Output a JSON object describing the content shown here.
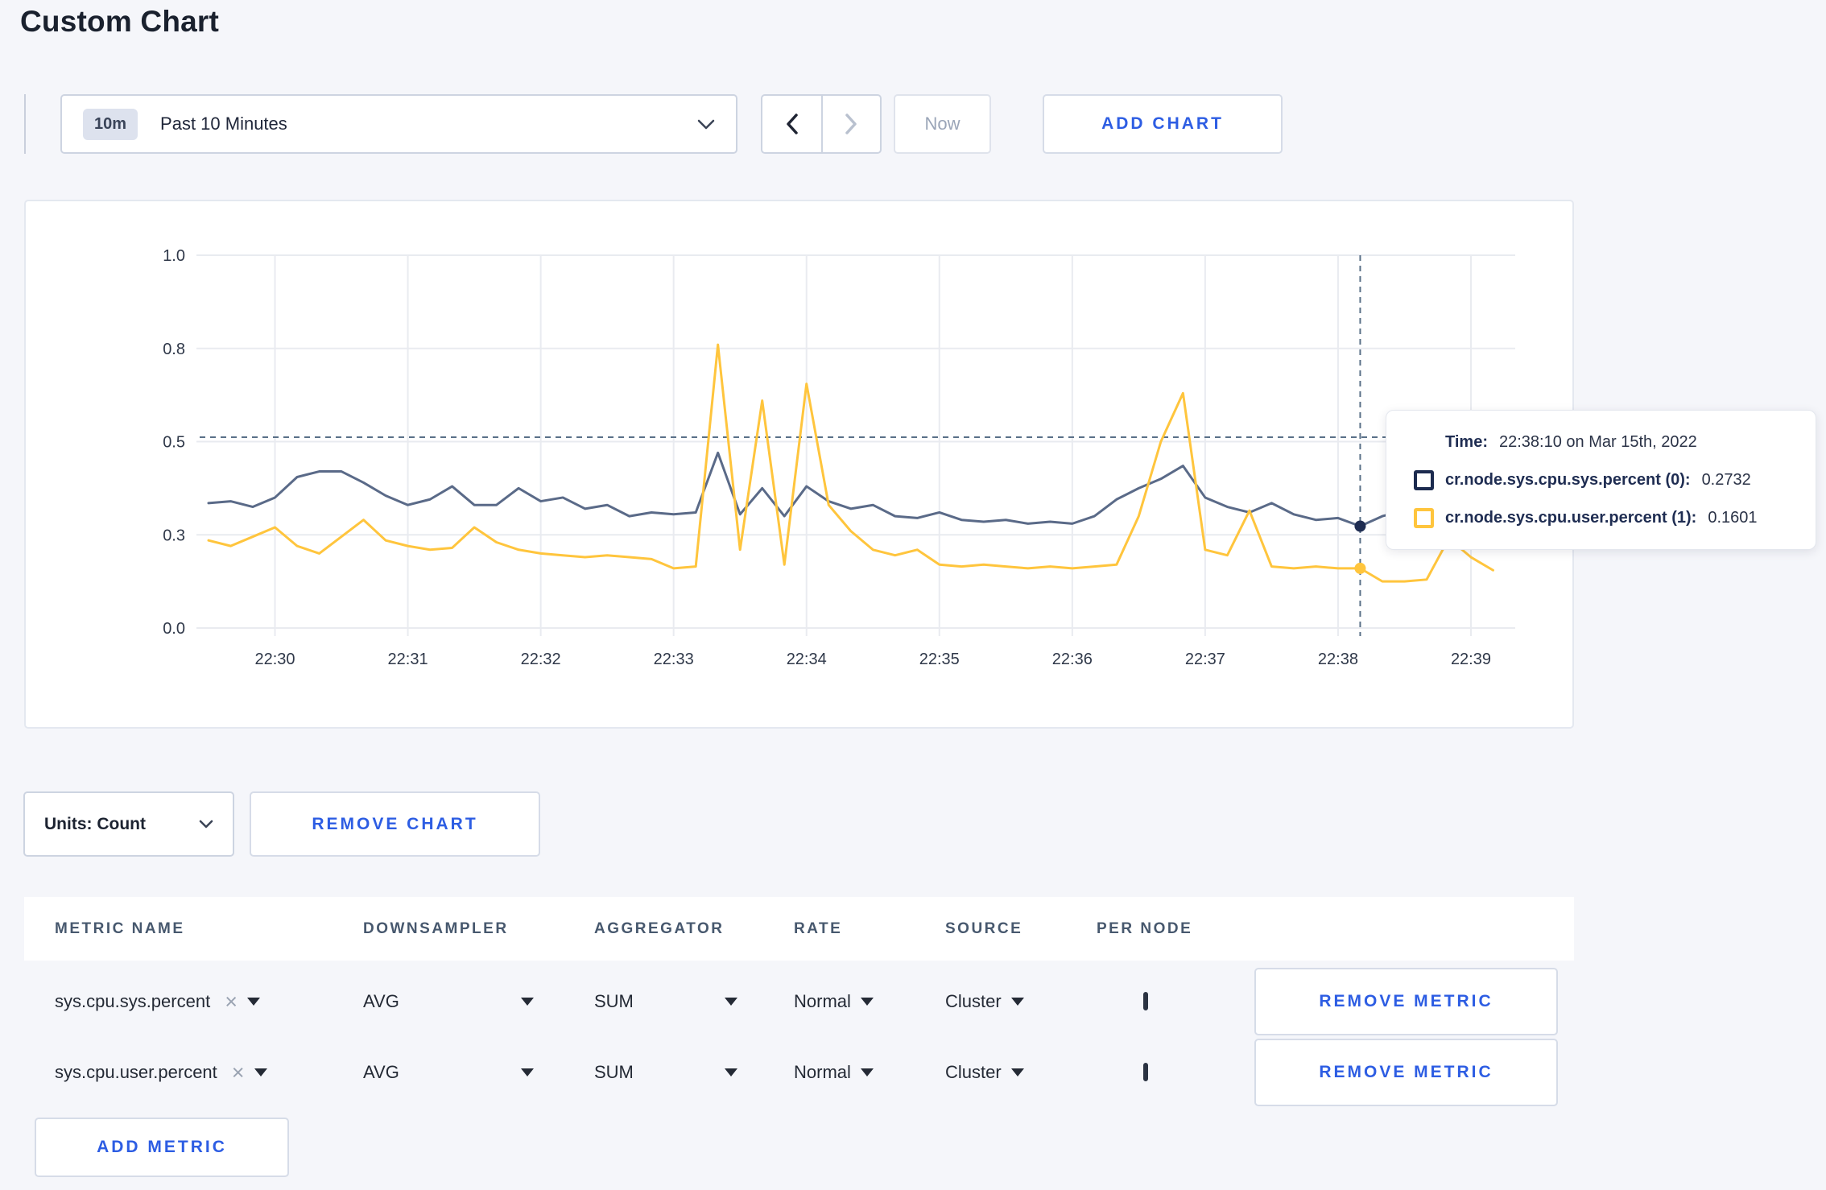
{
  "page": {
    "title": "Custom Chart"
  },
  "accent_color": "#2d5de3",
  "toolbar": {
    "time_scale_badge": "10m",
    "time_scale_label": "Past 10 Minutes",
    "now_label": "Now",
    "add_chart_label": "ADD CHART"
  },
  "chart_controls": {
    "units_label": "Units: Count",
    "remove_chart_label": "REMOVE CHART",
    "add_metric_label": "ADD METRIC"
  },
  "tooltip": {
    "time_label": "Time:",
    "time_value": "22:38:10 on Mar 15th, 2022",
    "series": [
      {
        "label": "cr.node.sys.cpu.sys.percent (0):",
        "value": "0.2732",
        "color": "#1c2b4f"
      },
      {
        "label": "cr.node.sys.cpu.user.percent (1):",
        "value": "0.1601",
        "color": "#ffc53d"
      }
    ]
  },
  "metrics_table": {
    "headers": [
      "METRIC NAME",
      "DOWNSAMPLER",
      "AGGREGATOR",
      "RATE",
      "SOURCE",
      "PER NODE"
    ],
    "rows": [
      {
        "metric": "sys.cpu.sys.percent",
        "clear": "×",
        "downsampler": "AVG",
        "aggregator": "SUM",
        "rate": "Normal",
        "source": "Cluster",
        "per_node_checked": false,
        "remove_label": "REMOVE METRIC"
      },
      {
        "metric": "sys.cpu.user.percent",
        "clear": "×",
        "downsampler": "AVG",
        "aggregator": "SUM",
        "rate": "Normal",
        "source": "Cluster",
        "per_node_checked": false,
        "remove_label": "REMOVE METRIC"
      }
    ]
  },
  "chart_data": {
    "type": "line",
    "grid": true,
    "ylim": [
      0,
      1
    ],
    "y_ticks": [
      {
        "label": "0.0",
        "value": 0
      },
      {
        "label": "0.3",
        "value": 0.25
      },
      {
        "label": "0.5",
        "value": 0.5
      },
      {
        "label": "0.8",
        "value": 0.75
      },
      {
        "label": "1.0",
        "value": 1.0
      }
    ],
    "x_ticks": [
      "22:30",
      "22:31",
      "22:32",
      "22:33",
      "22:34",
      "22:35",
      "22:36",
      "22:37",
      "22:38",
      "22:39"
    ],
    "start_time": "22:29:30",
    "step_seconds": 10,
    "crosshair": {
      "time": "22:38:10",
      "s": 490,
      "hline_value": 0.512
    },
    "series": [
      {
        "name": "cr.node.sys.cpu.sys.percent",
        "color": "#5a6a88",
        "dot_color": "#1f2d52",
        "hover_value": 0.2732,
        "values": [
          0.335,
          0.34,
          0.325,
          0.35,
          0.405,
          0.42,
          0.42,
          0.39,
          0.355,
          0.33,
          0.345,
          0.38,
          0.33,
          0.33,
          0.375,
          0.34,
          0.35,
          0.32,
          0.33,
          0.3,
          0.31,
          0.305,
          0.31,
          0.47,
          0.305,
          0.375,
          0.3,
          0.38,
          0.34,
          0.32,
          0.33,
          0.3,
          0.295,
          0.31,
          0.29,
          0.285,
          0.29,
          0.28,
          0.285,
          0.28,
          0.3,
          0.345,
          0.375,
          0.4,
          0.435,
          0.35,
          0.325,
          0.31,
          0.335,
          0.305,
          0.29,
          0.295,
          0.2732,
          0.3,
          0.315,
          0.3,
          0.295,
          0.3,
          0.31
        ]
      },
      {
        "name": "cr.node.sys.cpu.user.percent",
        "color": "#ffc53d",
        "dot_color": "#ffc53d",
        "hover_value": 0.1601,
        "values": [
          0.235,
          0.22,
          0.245,
          0.27,
          0.22,
          0.2,
          0.245,
          0.29,
          0.235,
          0.22,
          0.21,
          0.215,
          0.27,
          0.23,
          0.21,
          0.2,
          0.195,
          0.19,
          0.195,
          0.19,
          0.185,
          0.16,
          0.165,
          0.76,
          0.21,
          0.61,
          0.17,
          0.655,
          0.33,
          0.26,
          0.21,
          0.195,
          0.21,
          0.17,
          0.165,
          0.17,
          0.165,
          0.16,
          0.165,
          0.16,
          0.165,
          0.17,
          0.3,
          0.5,
          0.63,
          0.21,
          0.195,
          0.315,
          0.165,
          0.16,
          0.165,
          0.16,
          0.1601,
          0.125,
          0.125,
          0.13,
          0.24,
          0.19,
          0.155
        ]
      }
    ]
  }
}
